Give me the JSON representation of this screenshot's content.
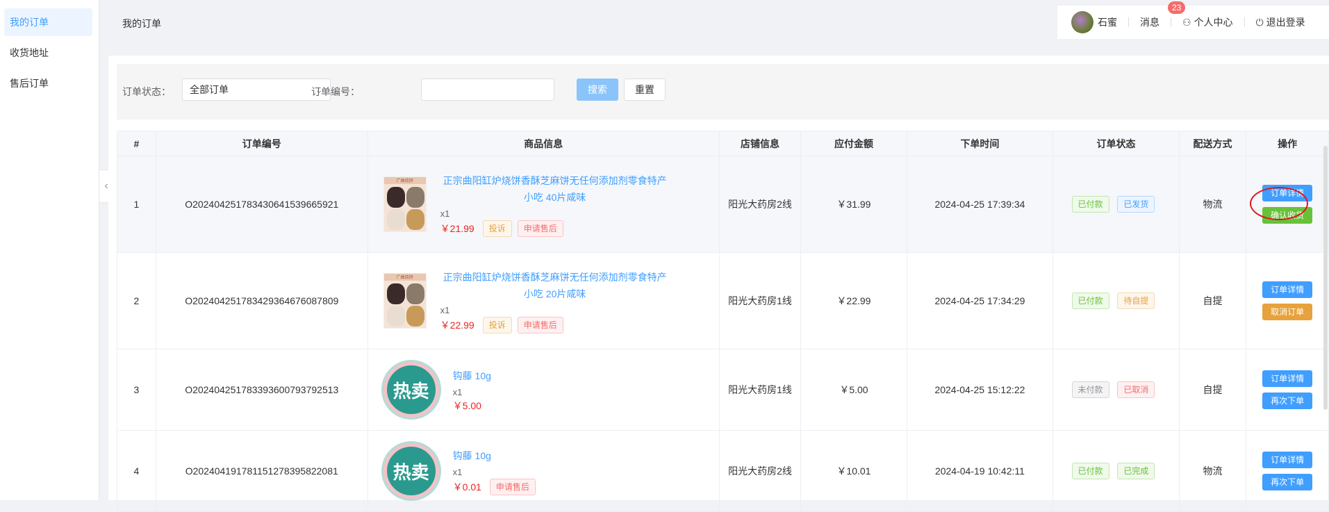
{
  "sidebar": {
    "items": [
      "我的订单",
      "收货地址",
      "售后订单"
    ]
  },
  "header": {
    "page_title": "我的订单",
    "username": "石蜜",
    "message_label": "消息",
    "message_count": "23",
    "personal_center": "个人中心",
    "logout": "退出登录"
  },
  "filter": {
    "status_label": "订单状态：",
    "status_value": "全部订单",
    "order_no_label": "订单编号：",
    "order_no_value": "",
    "search_btn": "搜索",
    "reset_btn": "重置"
  },
  "table": {
    "headers": [
      "#",
      "订单编号",
      "商品信息",
      "店铺信息",
      "应付金额",
      "下单时间",
      "订单状态",
      "配送方式",
      "操作"
    ],
    "rows": [
      {
        "index": "1",
        "order_no": "O202404251783430641539665921",
        "goods_name": "正宗曲阳缸炉烧饼香酥芝麻饼无任何添加剂零食特产小吃 40片咸味",
        "qty": "x1",
        "price": "￥21.99",
        "goods_tags": [
          "投诉",
          "申请售后"
        ],
        "shop": "阳光大药房2线",
        "amount": "￥31.99",
        "time": "2024-04-25 17:39:34",
        "status": [
          "已付款",
          "已发货"
        ],
        "delivery": "物流",
        "actions": [
          "订单详情",
          "确认收货"
        ]
      },
      {
        "index": "2",
        "order_no": "O202404251783429364676087809",
        "goods_name": "正宗曲阳缸炉烧饼香酥芝麻饼无任何添加剂零食特产小吃 20片咸味",
        "qty": "x1",
        "price": "￥22.99",
        "goods_tags": [
          "投诉",
          "申请售后"
        ],
        "shop": "阳光大药房1线",
        "amount": "￥22.99",
        "time": "2024-04-25 17:34:29",
        "status": [
          "已付款",
          "待自提"
        ],
        "delivery": "自提",
        "actions": [
          "订单详情",
          "取消订单"
        ]
      },
      {
        "index": "3",
        "order_no": "O202404251783393600793792513",
        "goods_name": "钩藤 10g",
        "qty": "x1",
        "price": "￥5.00",
        "goods_tags": [],
        "shop": "阳光大药房1线",
        "amount": "￥5.00",
        "time": "2024-04-25 15:12:22",
        "status": [
          "未付款",
          "已取消"
        ],
        "delivery": "自提",
        "actions": [
          "订单详情",
          "再次下单"
        ]
      },
      {
        "index": "4",
        "order_no": "O202404191781151278395822081",
        "goods_name": "钩藤 10g",
        "qty": "x1",
        "price": "￥0.01",
        "goods_tags": [
          "申请售后"
        ],
        "shop": "阳光大药房2线",
        "amount": "￥10.01",
        "time": "2024-04-19 10:42:11",
        "status": [
          "已付款",
          "已完成"
        ],
        "delivery": "物流",
        "actions": [
          "订单详情",
          "再次下单"
        ]
      }
    ]
  },
  "hot_image_text": "热卖",
  "cookie_image_band": "广曲烧饼"
}
